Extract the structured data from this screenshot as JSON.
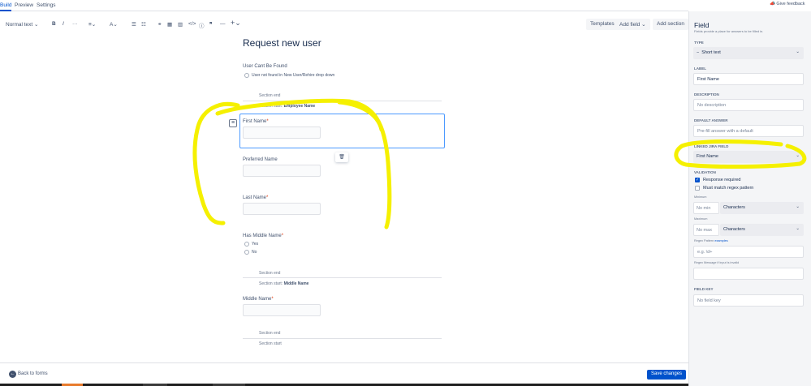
{
  "nav": {
    "tabs": [
      "Build",
      "Preview",
      "Settings"
    ],
    "feedback": "Give feedback"
  },
  "toolbar": {
    "text_style": "Normal text",
    "templates": "Templates",
    "add_field": "Add field",
    "add_section": "Add section"
  },
  "form": {
    "title": "Request new user",
    "q1_label": "User Cant Be Found",
    "q1_option": "User not found in New User/Rehire drop down",
    "section_end_1": "Section end",
    "section_start_1_prefix": "Section start:",
    "section_start_1_name": "Employee Name",
    "first_name": "First Name",
    "preferred_name": "Preferred Name",
    "last_name": "Last Name",
    "has_middle": "Has Middle Name",
    "opt_yes": "Yes",
    "opt_no": "No",
    "section_end_2": "Section end",
    "section_start_2_prefix": "Section start:",
    "section_start_2_name": "Middle Name",
    "middle_name": "Middle Name",
    "section_end_3": "Section end",
    "section_start_3": "Section start",
    "required_mark": "*"
  },
  "footer": {
    "back": "Back to forms",
    "save": "Save changes"
  },
  "panel": {
    "title": "Field",
    "subtitle": "Fields provide a place for answers to be filled in.",
    "type_label": "TYPE",
    "type_value": "Short text",
    "label_label": "LABEL",
    "label_value": "First Name",
    "desc_label": "DESCRIPTION",
    "desc_placeholder": "No description",
    "default_label": "DEFAULT ANSWER",
    "default_placeholder": "Pre-fill answer with a default",
    "linked_label": "LINKED JIRA FIELD",
    "linked_value": "First Name",
    "validation_label": "VALIDATION",
    "response_required": "Response required",
    "regex_match": "Must match regex pattern",
    "minimum": "Minimum",
    "min_placeholder": "No min",
    "min_unit": "Characters",
    "maximum": "Maximum",
    "max_placeholder": "No max",
    "max_unit": "Characters",
    "regex_pattern_label": "Regex Pattern",
    "regex_examples": "examples",
    "regex_placeholder": "e.g. \\d+",
    "regex_message_label": "Regex Message if input is invalid",
    "field_key_label": "FIELD KEY",
    "field_key_placeholder": "No field key"
  },
  "colors": {
    "accent": "#0052cc",
    "annotation": "#f5f000"
  }
}
